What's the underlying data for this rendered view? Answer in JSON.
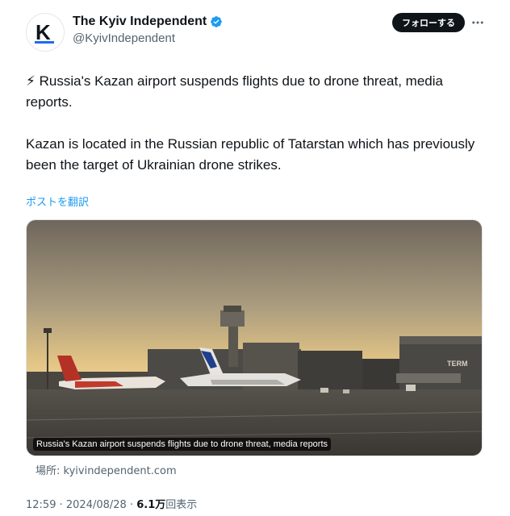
{
  "account": {
    "display_name": "The Kyiv Independent",
    "handle": "@KyivIndependent",
    "avatar_letter": "K",
    "verified": true,
    "follow_label": "フォローする",
    "brand_color": "#0f1419",
    "verified_color": "#1d9bf0"
  },
  "tweet": {
    "paragraph_1": "⚡ Russia's Kazan airport suspends flights due to drone threat, media reports.",
    "paragraph_2": "Kazan is located in the Russian republic of Tatarstan which has previously been the target of Ukrainian drone strikes.",
    "translate_label": "ポストを翻訳"
  },
  "media": {
    "caption": "Russia's Kazan airport suspends flights due to drone threat, media reports",
    "terminal_sign": "TERM",
    "source_label": "場所: kyivindependent.com"
  },
  "footer": {
    "time": "12:59",
    "separator": "·",
    "date": "2024/08/28",
    "views_count": "6.1万",
    "views_label": "回表示"
  },
  "icons": {
    "verified": "verified-badge-icon",
    "more": "more-dots-icon"
  }
}
